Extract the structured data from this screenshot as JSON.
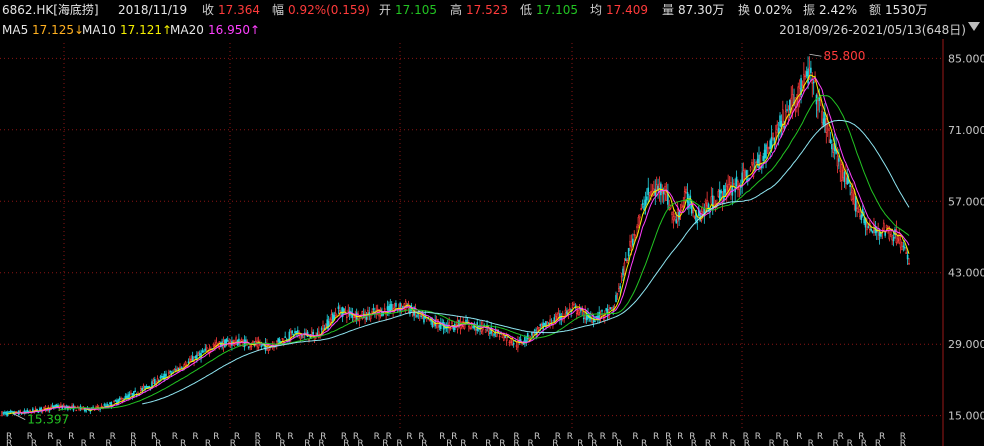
{
  "quote": {
    "symbol": "6862.HK[海底捞]",
    "date": "2018/11/19",
    "close_label": "收",
    "close": "17.364",
    "change_label": "幅",
    "change": "0.92%(0.159)",
    "open_label": "开",
    "open": "17.105",
    "high_label": "高",
    "high": "17.523",
    "low_label": "低",
    "low": "17.105",
    "avg_label": "均",
    "avg": "17.409",
    "volume_label": "量",
    "volume": "87.30万",
    "turnover_label": "换",
    "turnover": "0.02%",
    "amplitude_label": "振",
    "amplitude": "2.42%",
    "amount_label": "额",
    "amount": "1530万"
  },
  "ma": {
    "ma5_label": "MA5",
    "ma5": "17.125↓",
    "ma10_label": "MA10",
    "ma10": "17.121↑",
    "ma20_label": "MA20",
    "ma20": "16.950↑"
  },
  "range": "2018/09/26-2021/05/13(648日)",
  "colors": {
    "background": "#000000",
    "grid": "#8a1414",
    "up": "#ff3b3b",
    "down": "#24d4e0",
    "ma5": "#f5f000",
    "ma10": "#ff40ff",
    "ma20": "#22c322",
    "ma60": "#8fe6f2",
    "annotation_high": "#ff3b3b",
    "annotation_low": "#22c322"
  },
  "chart_data": {
    "type": "candlestick",
    "ylim": [
      12,
      88
    ],
    "y_ticks": [
      "85.000",
      "71.000",
      "57.000",
      "43.000",
      "29.000",
      "15.000"
    ],
    "y_tick_values": [
      85,
      71,
      57,
      43,
      29,
      15
    ],
    "annotations": [
      {
        "text": "85.800",
        "value": 85.8,
        "kind": "high"
      },
      {
        "text": "15.397",
        "value": 15.397,
        "kind": "low"
      }
    ],
    "anchors_index": [
      0,
      16,
      40,
      64,
      76,
      96,
      128,
      152,
      168,
      190,
      208,
      224,
      240,
      256,
      272,
      288,
      300,
      316,
      330,
      352,
      368,
      384,
      408,
      420,
      436,
      448,
      460,
      472,
      480,
      488,
      496,
      512,
      528,
      544,
      560,
      576,
      590,
      600,
      610,
      620,
      628,
      640,
      647
    ],
    "anchors_close": [
      15.4,
      15.6,
      16.8,
      16.2,
      17.0,
      19.5,
      24.5,
      28.8,
      29.5,
      28.5,
      31.0,
      30.5,
      35.5,
      34.5,
      35.5,
      36.5,
      34.0,
      32.5,
      33.0,
      31.5,
      29.0,
      32.0,
      36.0,
      34.0,
      35.5,
      48.0,
      58.0,
      60.0,
      53.0,
      58.0,
      54.0,
      58.0,
      61.0,
      66.0,
      74.5,
      82.0,
      70.0,
      62.0,
      56.0,
      51.0,
      51.5,
      50.0,
      45.0
    ],
    "r_row1": "R R R R R R R R R R R R R RR RR RR RR RR RR R R R R RR RRR R RRRR RR RR R R R R R R R",
    "r_row2": "R R R R R R R R R R R R RR RR RR R RR RRRR R RR R R R RR RR RR R RRRR R"
  }
}
